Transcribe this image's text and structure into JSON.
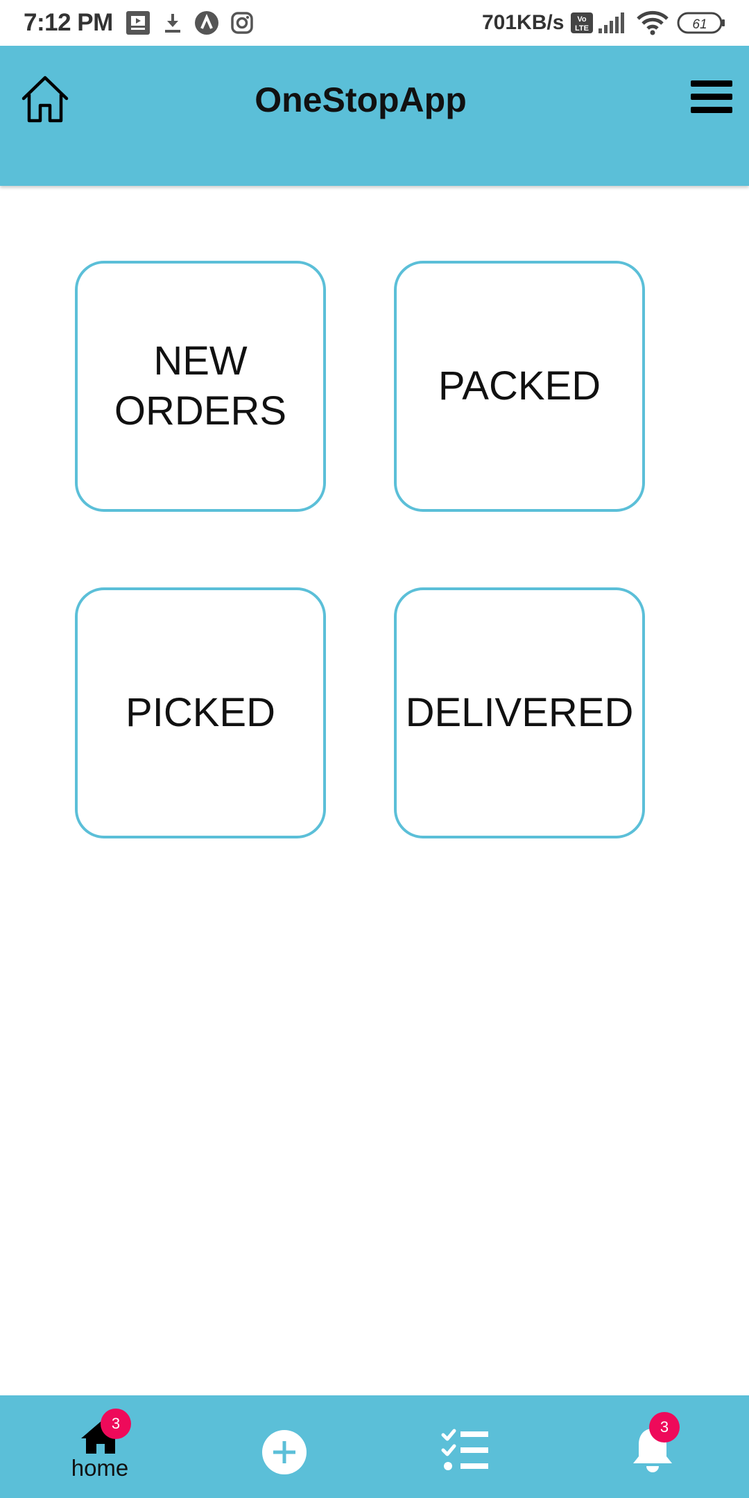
{
  "status_bar": {
    "time": "7:12 PM",
    "network_speed": "701KB/s",
    "volte_label": "Vo LTE",
    "battery_level": "61",
    "icons": [
      "screen-icon",
      "download-icon",
      "app-icon",
      "instagram-icon",
      "volte-icon",
      "signal-icon",
      "wifi-icon",
      "battery-icon"
    ]
  },
  "app_bar": {
    "title": "OneStopApp",
    "left_icon": "home-icon",
    "right_icon": "menu-icon"
  },
  "tiles": [
    {
      "label": "NEW\nORDERS"
    },
    {
      "label": "PACKED"
    },
    {
      "label": "PICKED"
    },
    {
      "label": "DELIVERED"
    }
  ],
  "bottom_nav": {
    "home": {
      "label": "home",
      "badge": "3",
      "icon": "home-icon"
    },
    "add": {
      "icon": "add-icon"
    },
    "tasks": {
      "icon": "checklist-icon"
    },
    "notifications": {
      "badge": "3",
      "icon": "bell-icon"
    }
  },
  "colors": {
    "accent": "#5bbfd8",
    "badge": "#ee0a5a",
    "text": "#111111",
    "background": "#ffffff"
  }
}
